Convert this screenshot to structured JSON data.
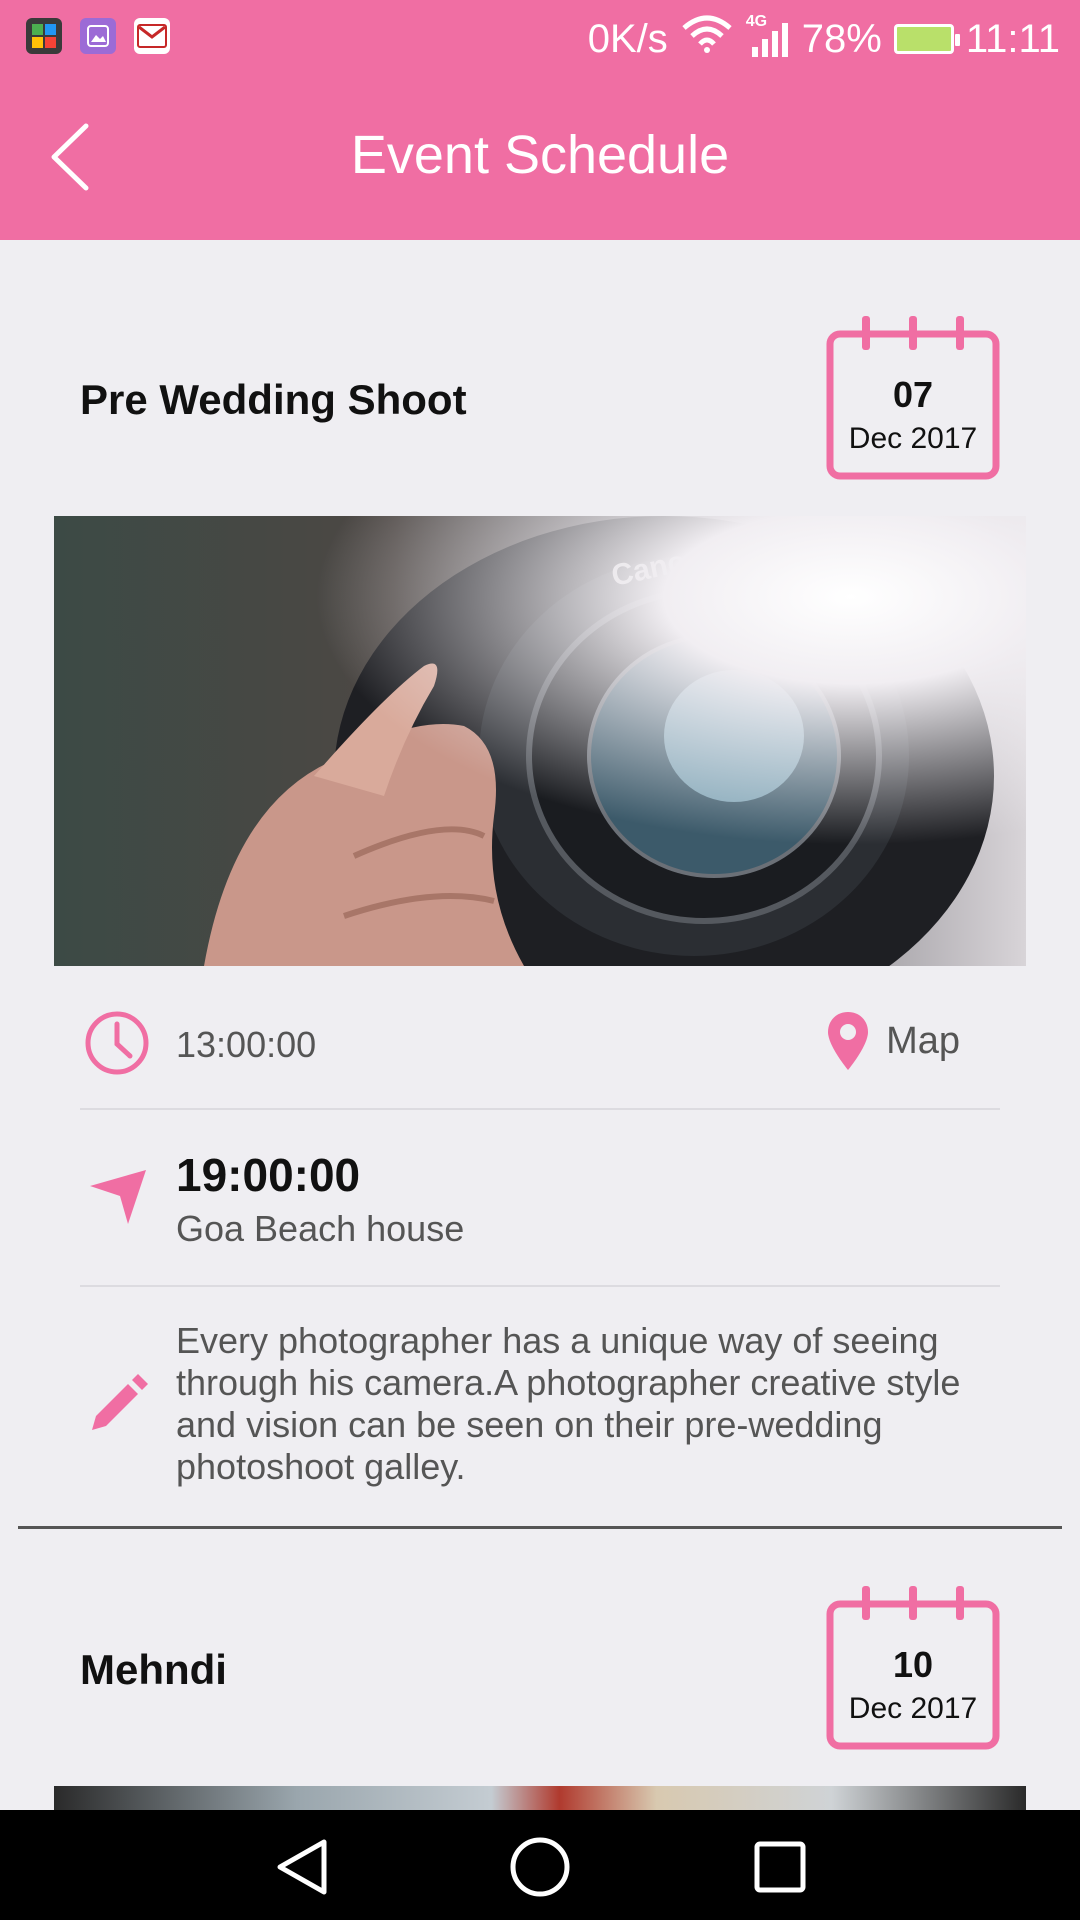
{
  "status_bar": {
    "net_speed": "0K/s",
    "network_type": "4G",
    "battery": "78%",
    "time": "11:11"
  },
  "app_bar": {
    "title": "Event Schedule"
  },
  "events": [
    {
      "title": "Pre Wedding Shoot",
      "day": "07",
      "month_year": "Dec 2017",
      "start_time": "13:00:00",
      "map_label": "Map",
      "end_time": "19:00:00",
      "venue": "Goa Beach house",
      "description": "Every photographer has a unique way of seeing through his camera.A photographer creative style  and vision can be seen on their pre-wedding photoshoot galley."
    },
    {
      "title": "Mehndi",
      "day": "10",
      "month_year": "Dec 2017"
    }
  ],
  "colors": {
    "accent": "#f06ea3",
    "background": "#efeef2",
    "nav_bar": "#000000"
  }
}
